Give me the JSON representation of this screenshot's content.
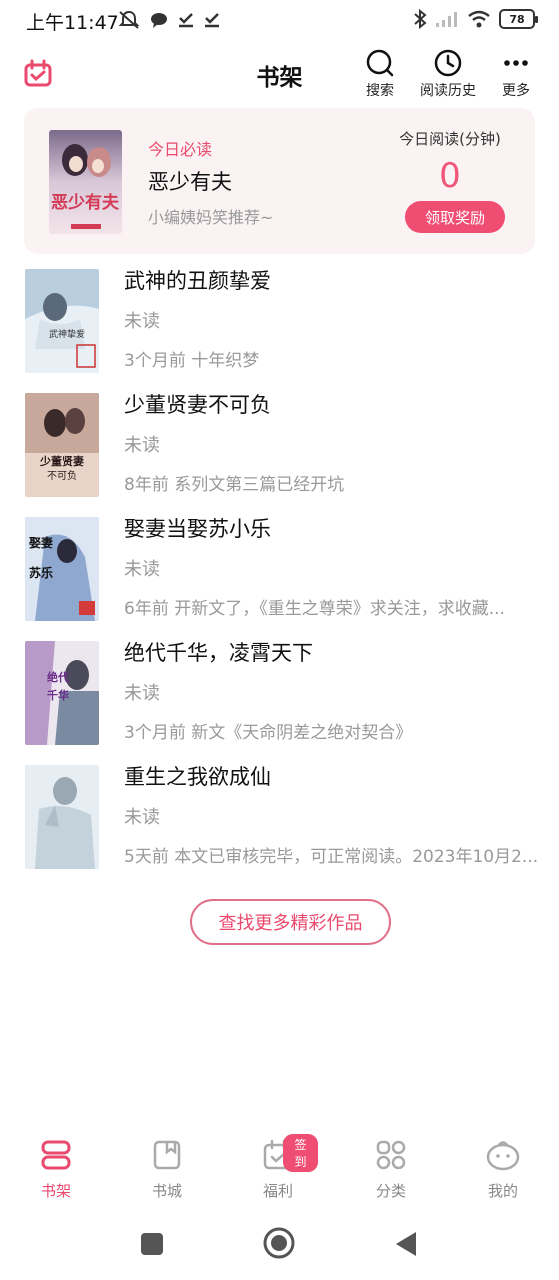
{
  "status_bar": {
    "time": "上午11:47",
    "battery": "78",
    "left_icons": [
      "mute-icon",
      "chat-icon",
      "check-icon",
      "check-icon"
    ],
    "right_icons": [
      "bluetooth-icon",
      "signal-icon",
      "wifi-icon",
      "battery-icon"
    ]
  },
  "header": {
    "title": "书架",
    "actions": [
      {
        "label": "搜索",
        "icon": "search-icon"
      },
      {
        "label": "阅读历史",
        "icon": "history-icon"
      },
      {
        "label": "更多",
        "icon": "more-icon"
      }
    ]
  },
  "today_card": {
    "tag": "今日必读",
    "book_title": "恶少有夫",
    "recommendation": "小编姨妈笑推荐~",
    "reading_label": "今日阅读(分钟)",
    "reading_minutes": "0",
    "reward_button": "领取奖励"
  },
  "books": [
    {
      "title": "武神的丑颜挚爱",
      "status": "未读",
      "update": "3个月前 十年织梦"
    },
    {
      "title": "少董贤妻不可负",
      "status": "未读",
      "update": "8年前 系列文第三篇已经开坑"
    },
    {
      "title": "娶妻当娶苏小乐",
      "status": "未读",
      "update": "6年前 开新文了，《重生之尊荣》求关注，求收藏..."
    },
    {
      "title": "绝代千华，凌霄天下",
      "status": "未读",
      "update": "3个月前 新文《天命阴差之绝对契合》"
    },
    {
      "title": "重生之我欲成仙",
      "status": "未读",
      "update": "5天前 本文已审核完毕，可正常阅读。2023年10月2..."
    }
  ],
  "find_more_button": "查找更多精彩作品",
  "bottom_nav": {
    "items": [
      {
        "label": "书架",
        "icon": "bookshelf-icon",
        "active": true
      },
      {
        "label": "书城",
        "icon": "bookstore-icon",
        "active": false
      },
      {
        "label": "福利",
        "icon": "welfare-calendar-icon",
        "active": false
      },
      {
        "label": "分类",
        "icon": "category-grid-icon",
        "active": false
      },
      {
        "label": "我的",
        "icon": "profile-face-icon",
        "active": false
      }
    ],
    "badge": "签到"
  },
  "colors": {
    "accent": "#e94a6d",
    "card_bg": "#fbf3f3",
    "muted_text": "#999999"
  }
}
